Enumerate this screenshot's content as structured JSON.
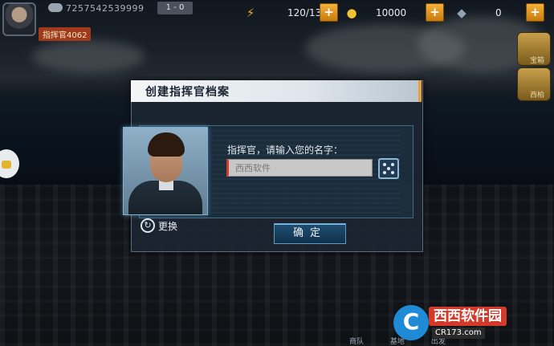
{
  "hud": {
    "player_id": "7257542539999",
    "vip_label": "1 - 0",
    "player_name": "指挥官4062",
    "energy": "120/130",
    "gold": "10000",
    "diamond": "0",
    "energy_icon": "lightning-icon",
    "gold_icon": "coin-stack-icon",
    "diamond_icon": "diamond-icon",
    "plus_label": "+",
    "side_buttons": [
      "宝箱",
      "西柏"
    ]
  },
  "dialog": {
    "title": "创建指挥官档案",
    "prompt": "指挥官，请输入您的名字：",
    "input_value": "西西软件",
    "swap_label": "更换",
    "confirm_label": "确定"
  },
  "watermark": {
    "logo_letter": "C",
    "site_name": "西西软件园",
    "domain": "CR173.com"
  },
  "bottom_tabs": [
    "商队",
    "基地",
    "出发"
  ]
}
